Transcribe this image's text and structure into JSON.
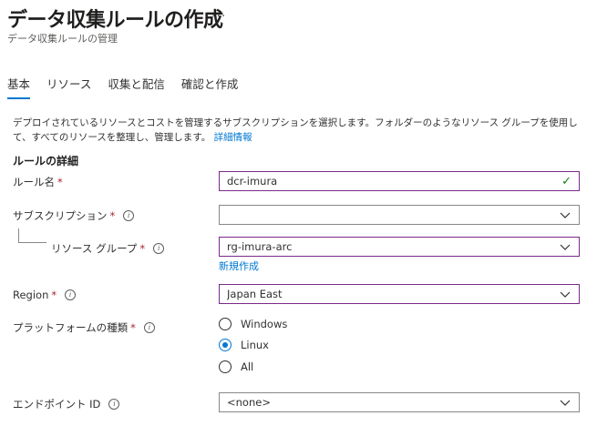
{
  "header": {
    "title": "データ収集ルールの作成",
    "more": "···",
    "subtitle": "データ収集ルールの管理"
  },
  "tabs": [
    {
      "label": "基本",
      "active": true
    },
    {
      "label": "リソース",
      "active": false
    },
    {
      "label": "収集と配信",
      "active": false
    },
    {
      "label": "確認と作成",
      "active": false
    }
  ],
  "description": {
    "text": "デプロイされているリソースとコストを管理するサブスクリプションを選択します。フォルダーのようなリソース グループを使用して、すべてのリソースを整理し、管理します。",
    "link": "詳細情報"
  },
  "section_title": "ルールの詳細",
  "form": {
    "rule_name": {
      "label": "ルール名",
      "required": "*",
      "value": "dcr-imura",
      "icon": "checkmark-icon"
    },
    "subscription": {
      "label": "サブスクリプション",
      "required": "*",
      "value": "",
      "icon": "info-icon"
    },
    "resource_group": {
      "label": "リソース グループ",
      "required": "*",
      "value": "rg-imura-arc",
      "create_new": "新規作成"
    },
    "region": {
      "label": "Region",
      "required": "*",
      "value": "Japan East"
    },
    "platform": {
      "label": "プラットフォームの種類",
      "required": "*",
      "options": [
        {
          "label": "Windows",
          "checked": false
        },
        {
          "label": "Linux",
          "checked": true
        },
        {
          "label": "All",
          "checked": false
        }
      ]
    },
    "endpoint": {
      "label": "エンドポイント ID",
      "value": "<none>"
    }
  },
  "colors": {
    "accent": "#0078d4",
    "focus_border": "#7a2a8a",
    "required": "#a4262c",
    "valid": "#107c10"
  }
}
